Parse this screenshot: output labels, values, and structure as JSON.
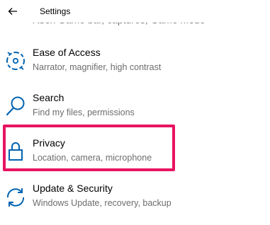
{
  "header": {
    "title": "Settings",
    "back_icon": "back-arrow-icon"
  },
  "partial_item": {
    "description": "Xbox Game bar, captures, Game Mode"
  },
  "items": [
    {
      "label": "Ease of Access",
      "description": "Narrator, magnifier, high contrast",
      "icon": "ease-of-access-icon"
    },
    {
      "label": "Search",
      "description": "Find my files, permissions",
      "icon": "search-icon"
    },
    {
      "label": "Privacy",
      "description": "Location, camera, microphone",
      "icon": "lock-icon",
      "highlighted": true
    },
    {
      "label": "Update & Security",
      "description": "Windows Update, recovery, backup",
      "icon": "sync-icon"
    }
  ],
  "colors": {
    "accent": "#0063b1",
    "highlight": "#e8145f",
    "secondary_text": "#6d6d6d"
  }
}
